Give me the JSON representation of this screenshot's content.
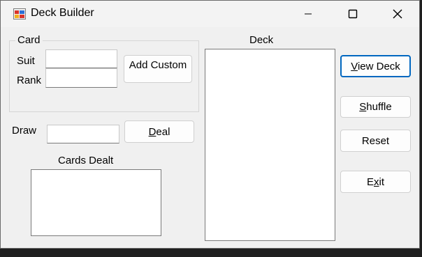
{
  "window": {
    "title": "Deck Builder"
  },
  "card_group": {
    "legend": "Card",
    "suit_label": "Suit",
    "suit_value": "",
    "rank_label": "Rank",
    "rank_value": "",
    "add_custom_label": "Add Custom"
  },
  "draw": {
    "label": "Draw",
    "value": "",
    "deal_button": {
      "mnemonic": "D",
      "rest": "eal"
    }
  },
  "cards_dealt": {
    "label": "Cards Dealt",
    "items": []
  },
  "deck": {
    "label": "Deck",
    "items": []
  },
  "buttons": {
    "view_deck": {
      "mnemonic": "V",
      "rest": "iew Deck"
    },
    "shuffle": {
      "mnemonic": "S",
      "rest": "huffle"
    },
    "reset": {
      "label": "Reset"
    },
    "exit": {
      "pre": "E",
      "mnemonic": "x",
      "rest": "it"
    }
  },
  "colors": {
    "focus_border": "#0067c0",
    "window_bg": "#f0f0f0",
    "titlebar_bg": "#f3f3f3"
  }
}
